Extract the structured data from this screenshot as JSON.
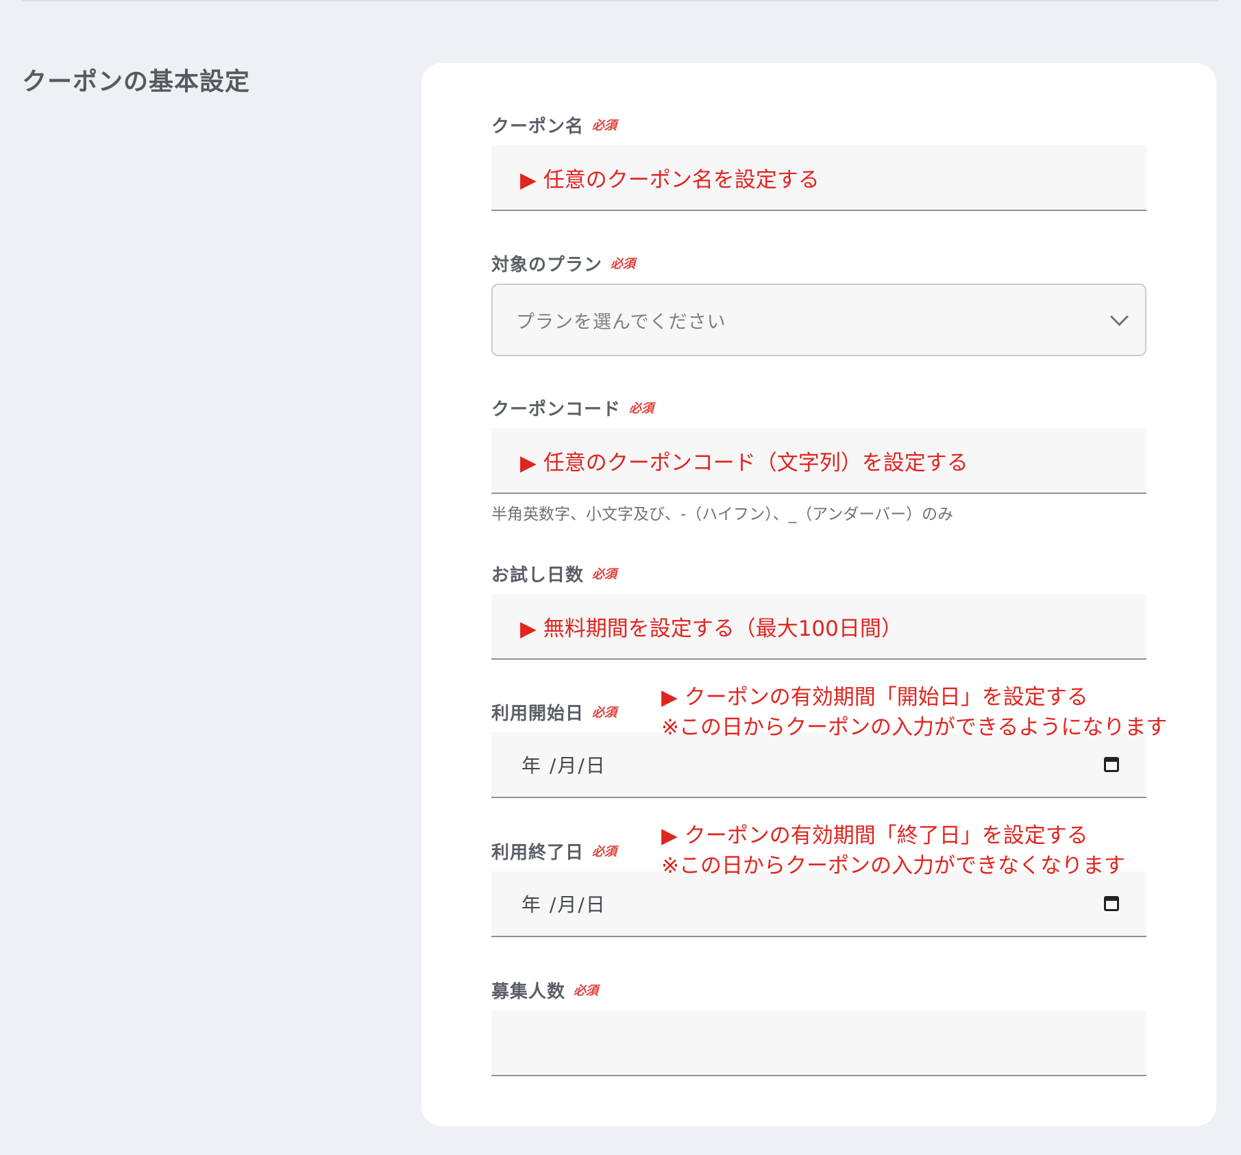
{
  "section": {
    "title": "クーポンの基本設定"
  },
  "required_badge": "必須",
  "fields": {
    "coupon_name": {
      "label": "クーポン名",
      "value": "▶ 任意のクーポン名を設定する"
    },
    "plan": {
      "label": "対象のプラン",
      "placeholder": "プランを選んでください"
    },
    "coupon_code": {
      "label": "クーポンコード",
      "value": "▶ 任意のクーポンコード（文字列）を設定する",
      "hint": "半角英数字、小文字及び、-（ハイフン）、_（アンダーバー）のみ"
    },
    "trial_days": {
      "label": "お試し日数",
      "value": "▶ 無料期間を設定する（最大100日間）"
    },
    "start_date": {
      "label": "利用開始日",
      "placeholder": "年 /月/日",
      "note_line1": "▶ クーポンの有効期間「開始日」を設定する",
      "note_line2": "※この日からクーポンの入力ができるようになります"
    },
    "end_date": {
      "label": "利用終了日",
      "placeholder": "年 /月/日",
      "note_line1": "▶ クーポンの有効期間「終了日」を設定する",
      "note_line2": "※この日からクーポンの入力ができなくなります"
    },
    "recruit_count": {
      "label": "募集人数",
      "value": ""
    }
  }
}
